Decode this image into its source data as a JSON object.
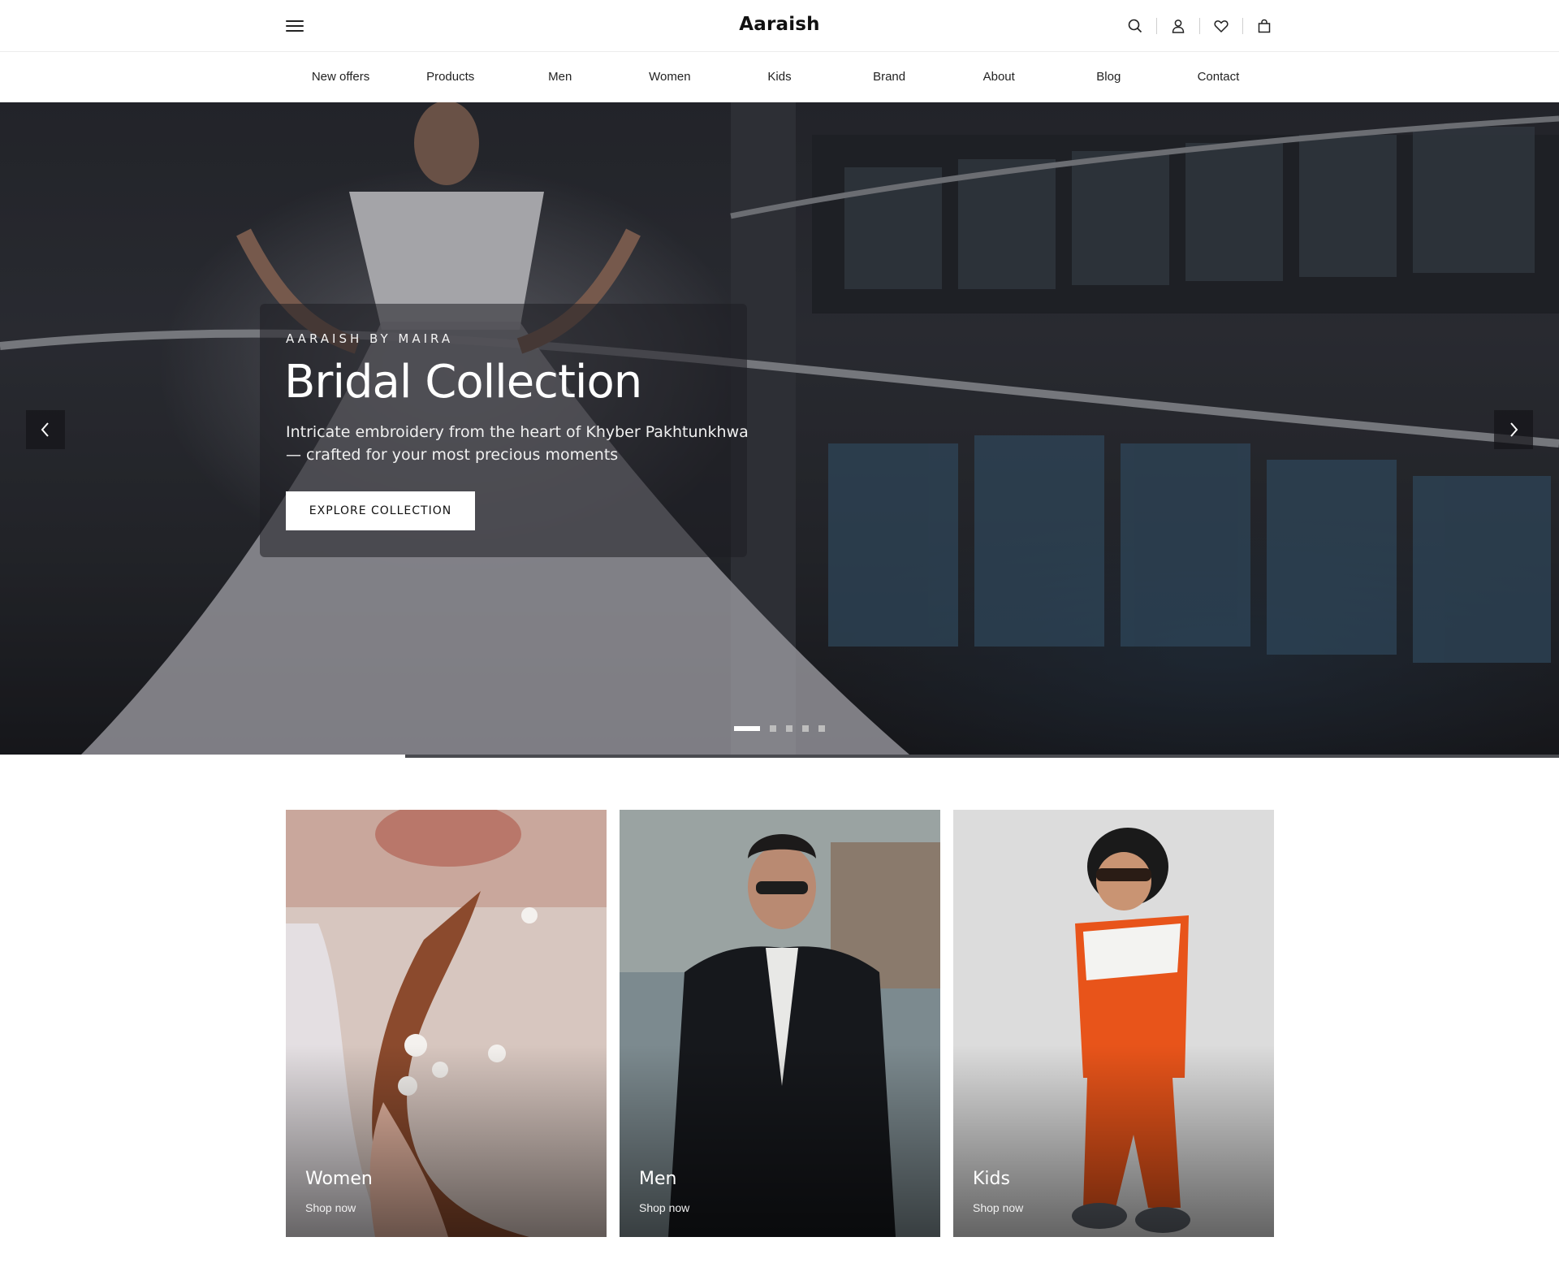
{
  "brand": {
    "logo": "Aaraish"
  },
  "header": {
    "icons": [
      "menu-icon",
      "search-icon",
      "user-icon",
      "heart-icon",
      "bag-icon"
    ]
  },
  "nav": {
    "items": [
      "New offers",
      "Products",
      "Men",
      "Women",
      "Kids",
      "Brand",
      "About",
      "Blog",
      "Contact"
    ]
  },
  "hero": {
    "eyebrow": "AARAISH BY MAIRA",
    "title": "Bridal Collection",
    "subtitle": "Intricate embroidery from the heart of Khyber Pakhtunkhwa — crafted for your most precious moments",
    "cta": "EXPLORE COLLECTION",
    "slide_count": 5,
    "active_slide": 1,
    "autoplay_progress": 0.26
  },
  "categories": [
    {
      "label": "Women",
      "cta": "Shop now"
    },
    {
      "label": "Men",
      "cta": "Shop now"
    },
    {
      "label": "Kids",
      "cta": "Shop now"
    }
  ],
  "colors": {
    "accent": "#111111",
    "hero_dark": "#2b2d33",
    "kids_orange": "#e8541a"
  }
}
